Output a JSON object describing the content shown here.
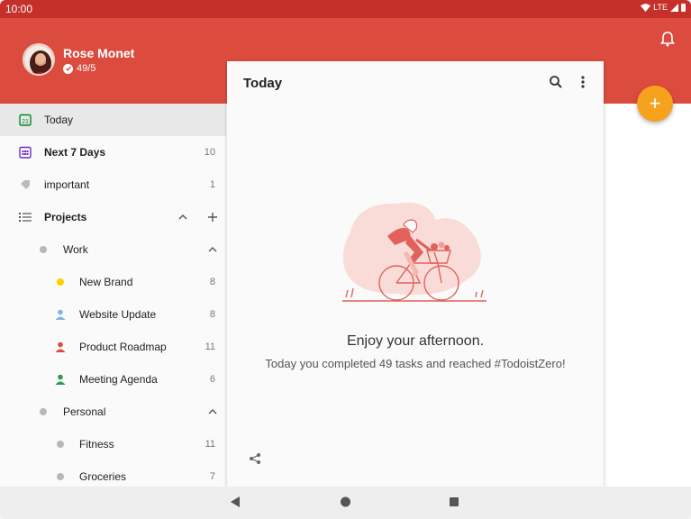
{
  "status_bar": {
    "time": "10:00",
    "network": "LTE"
  },
  "profile": {
    "name": "Rose Monet",
    "karma": "49/5"
  },
  "sidebar": {
    "items": [
      {
        "label": "Today",
        "count": ""
      },
      {
        "label": "Next 7 Days",
        "count": "10"
      },
      {
        "label": "important",
        "count": "1"
      },
      {
        "label": "Projects",
        "count": ""
      }
    ],
    "projects": [
      {
        "label": "Work",
        "count": ""
      },
      {
        "label": "New Brand",
        "count": "8"
      },
      {
        "label": "Website Update",
        "count": "8"
      },
      {
        "label": "Product Roadmap",
        "count": "11"
      },
      {
        "label": "Meeting Agenda",
        "count": "6"
      },
      {
        "label": "Personal",
        "count": ""
      },
      {
        "label": "Fitness",
        "count": "11"
      },
      {
        "label": "Groceries",
        "count": "7"
      }
    ]
  },
  "main": {
    "title": "Today",
    "empty_title": "Enjoy your afternoon.",
    "empty_subtitle": "Today you completed 49 tasks and reached #TodoistZero!"
  },
  "fab": {
    "label": "+"
  },
  "colors": {
    "brand_red": "#db4c3f",
    "status_bar": "#c5302a",
    "fab_orange": "#f7a21d",
    "new_brand_yellow": "#fad000",
    "website_blue": "#7fb6e6",
    "roadmap_red": "#db4c3f",
    "meeting_green": "#2a9d4b",
    "grey_dot": "#b8b8b8"
  },
  "icons": {
    "today": "calendar-day-icon",
    "next7": "calendar-week-icon",
    "label": "tag-icon",
    "projects": "list-icon",
    "search": "search-icon",
    "more": "more-vert-icon",
    "share": "share-icon",
    "bell": "bell-icon"
  }
}
